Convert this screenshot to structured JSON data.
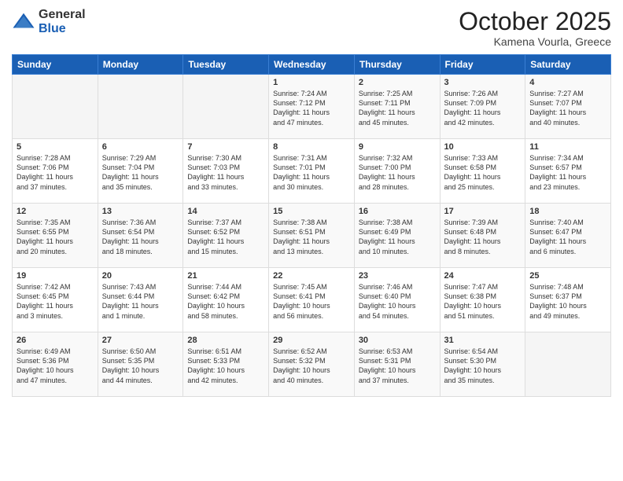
{
  "logo": {
    "general": "General",
    "blue": "Blue"
  },
  "header": {
    "month": "October 2025",
    "location": "Kamena Vourla, Greece"
  },
  "days_of_week": [
    "Sunday",
    "Monday",
    "Tuesday",
    "Wednesday",
    "Thursday",
    "Friday",
    "Saturday"
  ],
  "weeks": [
    [
      {
        "day": "",
        "info": ""
      },
      {
        "day": "",
        "info": ""
      },
      {
        "day": "",
        "info": ""
      },
      {
        "day": "1",
        "info": "Sunrise: 7:24 AM\nSunset: 7:12 PM\nDaylight: 11 hours\nand 47 minutes."
      },
      {
        "day": "2",
        "info": "Sunrise: 7:25 AM\nSunset: 7:11 PM\nDaylight: 11 hours\nand 45 minutes."
      },
      {
        "day": "3",
        "info": "Sunrise: 7:26 AM\nSunset: 7:09 PM\nDaylight: 11 hours\nand 42 minutes."
      },
      {
        "day": "4",
        "info": "Sunrise: 7:27 AM\nSunset: 7:07 PM\nDaylight: 11 hours\nand 40 minutes."
      }
    ],
    [
      {
        "day": "5",
        "info": "Sunrise: 7:28 AM\nSunset: 7:06 PM\nDaylight: 11 hours\nand 37 minutes."
      },
      {
        "day": "6",
        "info": "Sunrise: 7:29 AM\nSunset: 7:04 PM\nDaylight: 11 hours\nand 35 minutes."
      },
      {
        "day": "7",
        "info": "Sunrise: 7:30 AM\nSunset: 7:03 PM\nDaylight: 11 hours\nand 33 minutes."
      },
      {
        "day": "8",
        "info": "Sunrise: 7:31 AM\nSunset: 7:01 PM\nDaylight: 11 hours\nand 30 minutes."
      },
      {
        "day": "9",
        "info": "Sunrise: 7:32 AM\nSunset: 7:00 PM\nDaylight: 11 hours\nand 28 minutes."
      },
      {
        "day": "10",
        "info": "Sunrise: 7:33 AM\nSunset: 6:58 PM\nDaylight: 11 hours\nand 25 minutes."
      },
      {
        "day": "11",
        "info": "Sunrise: 7:34 AM\nSunset: 6:57 PM\nDaylight: 11 hours\nand 23 minutes."
      }
    ],
    [
      {
        "day": "12",
        "info": "Sunrise: 7:35 AM\nSunset: 6:55 PM\nDaylight: 11 hours\nand 20 minutes."
      },
      {
        "day": "13",
        "info": "Sunrise: 7:36 AM\nSunset: 6:54 PM\nDaylight: 11 hours\nand 18 minutes."
      },
      {
        "day": "14",
        "info": "Sunrise: 7:37 AM\nSunset: 6:52 PM\nDaylight: 11 hours\nand 15 minutes."
      },
      {
        "day": "15",
        "info": "Sunrise: 7:38 AM\nSunset: 6:51 PM\nDaylight: 11 hours\nand 13 minutes."
      },
      {
        "day": "16",
        "info": "Sunrise: 7:38 AM\nSunset: 6:49 PM\nDaylight: 11 hours\nand 10 minutes."
      },
      {
        "day": "17",
        "info": "Sunrise: 7:39 AM\nSunset: 6:48 PM\nDaylight: 11 hours\nand 8 minutes."
      },
      {
        "day": "18",
        "info": "Sunrise: 7:40 AM\nSunset: 6:47 PM\nDaylight: 11 hours\nand 6 minutes."
      }
    ],
    [
      {
        "day": "19",
        "info": "Sunrise: 7:42 AM\nSunset: 6:45 PM\nDaylight: 11 hours\nand 3 minutes."
      },
      {
        "day": "20",
        "info": "Sunrise: 7:43 AM\nSunset: 6:44 PM\nDaylight: 11 hours\nand 1 minute."
      },
      {
        "day": "21",
        "info": "Sunrise: 7:44 AM\nSunset: 6:42 PM\nDaylight: 10 hours\nand 58 minutes."
      },
      {
        "day": "22",
        "info": "Sunrise: 7:45 AM\nSunset: 6:41 PM\nDaylight: 10 hours\nand 56 minutes."
      },
      {
        "day": "23",
        "info": "Sunrise: 7:46 AM\nSunset: 6:40 PM\nDaylight: 10 hours\nand 54 minutes."
      },
      {
        "day": "24",
        "info": "Sunrise: 7:47 AM\nSunset: 6:38 PM\nDaylight: 10 hours\nand 51 minutes."
      },
      {
        "day": "25",
        "info": "Sunrise: 7:48 AM\nSunset: 6:37 PM\nDaylight: 10 hours\nand 49 minutes."
      }
    ],
    [
      {
        "day": "26",
        "info": "Sunrise: 6:49 AM\nSunset: 5:36 PM\nDaylight: 10 hours\nand 47 minutes."
      },
      {
        "day": "27",
        "info": "Sunrise: 6:50 AM\nSunset: 5:35 PM\nDaylight: 10 hours\nand 44 minutes."
      },
      {
        "day": "28",
        "info": "Sunrise: 6:51 AM\nSunset: 5:33 PM\nDaylight: 10 hours\nand 42 minutes."
      },
      {
        "day": "29",
        "info": "Sunrise: 6:52 AM\nSunset: 5:32 PM\nDaylight: 10 hours\nand 40 minutes."
      },
      {
        "day": "30",
        "info": "Sunrise: 6:53 AM\nSunset: 5:31 PM\nDaylight: 10 hours\nand 37 minutes."
      },
      {
        "day": "31",
        "info": "Sunrise: 6:54 AM\nSunset: 5:30 PM\nDaylight: 10 hours\nand 35 minutes."
      },
      {
        "day": "",
        "info": ""
      }
    ]
  ]
}
